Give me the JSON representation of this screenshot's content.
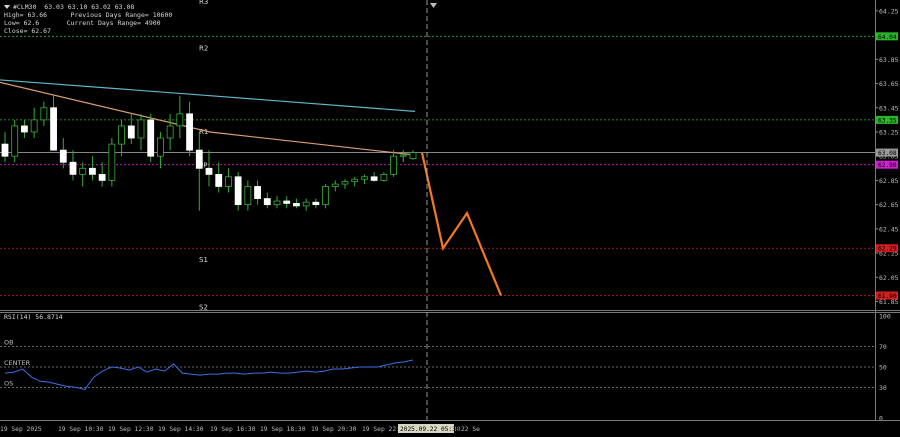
{
  "symbol_header": {
    "symbol_line": "#CLM30  63.03 63.10 63.02 63.08",
    "high": "High= 63.66",
    "prev_range": "Previous Days Range= 10600",
    "low": "Low= 62.6",
    "curr_range": "Current Days Range= 4900",
    "close": "Close= 62.67"
  },
  "pivot_labels": {
    "r2": "R2",
    "r1": "R1",
    "pp": "PP",
    "s1": "S1",
    "s2": "S2",
    "top_clipped": "R3"
  },
  "price_axis": {
    "ticks": [
      "64.25",
      "64.05",
      "63.85",
      "63.65",
      "63.45",
      "63.25",
      "63.05",
      "62.85",
      "62.65",
      "62.45",
      "62.25",
      "62.05",
      "61.85"
    ],
    "tags": [
      {
        "label": "64.04",
        "price": 64.04,
        "color": "#2bb52b"
      },
      {
        "label": "63.35",
        "price": 63.35,
        "color": "#2bb52b"
      },
      {
        "label": "63.08",
        "price": 63.08,
        "color": "#9a9a9a"
      },
      {
        "label": "62.98",
        "price": 62.98,
        "color": "#d020d0"
      },
      {
        "label": "62.29",
        "price": 62.29,
        "color": "#d02020"
      },
      {
        "label": "61.90",
        "price": 61.9,
        "color": "#d02020"
      }
    ]
  },
  "rsi": {
    "title": "RSI(14) 56.8714",
    "levels": {
      "ob": "OB",
      "center": "CENTER",
      "os": "OS"
    },
    "ticks": [
      "100",
      "70",
      "50",
      "30",
      "0"
    ],
    "values": [
      44,
      45,
      48,
      40,
      36,
      35,
      33,
      31,
      30,
      28,
      40,
      46,
      50,
      49,
      47,
      50,
      45,
      48,
      46,
      53,
      44,
      43,
      42,
      43,
      43,
      44,
      44,
      43,
      44,
      44,
      45,
      44,
      44,
      45,
      46,
      45,
      46,
      48,
      48,
      49,
      50,
      50,
      50,
      52,
      54,
      55,
      56.9
    ]
  },
  "time_axis": {
    "labels": [
      "19 Sep 2025",
      "19 Sep 10:30",
      "19 Sep 12:30",
      "19 Sep 14:30",
      "19 Sep 16:30",
      "19 Sep 18:30",
      "19 Sep 20:30",
      "19 Sep 22:30",
      "22 Sep 01:30",
      "22 Se"
    ],
    "cursor_label": "2025.09.22 05:30"
  },
  "chart_data": {
    "type": "candlestick",
    "y_range": [
      61.78,
      64.34
    ],
    "pivots": {
      "R2": 64.04,
      "R1": 63.35,
      "PP": 62.98,
      "S1": 62.29,
      "S2": 61.9
    },
    "candles": [
      [
        63.15,
        63.25,
        63.0,
        63.05
      ],
      [
        63.05,
        63.35,
        63.0,
        63.3
      ],
      [
        63.3,
        63.35,
        63.2,
        63.25
      ],
      [
        63.25,
        63.45,
        63.2,
        63.35
      ],
      [
        63.35,
        63.5,
        63.3,
        63.45
      ],
      [
        63.45,
        63.55,
        63.1,
        63.1
      ],
      [
        63.1,
        63.2,
        62.95,
        63.0
      ],
      [
        63.0,
        63.1,
        62.85,
        62.9
      ],
      [
        62.9,
        63.0,
        62.8,
        62.95
      ],
      [
        62.95,
        63.05,
        62.85,
        62.9
      ],
      [
        62.9,
        63.0,
        62.8,
        62.85
      ],
      [
        62.85,
        63.2,
        62.8,
        63.15
      ],
      [
        63.15,
        63.35,
        63.05,
        63.3
      ],
      [
        63.3,
        63.4,
        63.15,
        63.2
      ],
      [
        63.2,
        63.4,
        63.1,
        63.35
      ],
      [
        63.35,
        63.4,
        63.0,
        63.05
      ],
      [
        63.05,
        63.25,
        62.95,
        63.2
      ],
      [
        63.2,
        63.4,
        63.1,
        63.3
      ],
      [
        63.3,
        63.55,
        63.2,
        63.4
      ],
      [
        63.4,
        63.5,
        63.05,
        63.1
      ],
      [
        63.1,
        63.25,
        62.6,
        62.95
      ],
      [
        62.95,
        63.1,
        62.8,
        62.9
      ],
      [
        62.9,
        63.0,
        62.75,
        62.8
      ],
      [
        62.8,
        62.95,
        62.75,
        62.88
      ],
      [
        62.88,
        62.92,
        62.6,
        62.65
      ],
      [
        62.65,
        62.85,
        62.6,
        62.8
      ],
      [
        62.8,
        62.85,
        62.65,
        62.7
      ],
      [
        62.7,
        62.75,
        62.62,
        62.65
      ],
      [
        62.65,
        62.72,
        62.62,
        62.68
      ],
      [
        62.68,
        62.72,
        62.62,
        62.66
      ],
      [
        62.66,
        62.7,
        62.62,
        62.64
      ],
      [
        62.64,
        62.7,
        62.6,
        62.67
      ],
      [
        62.67,
        62.7,
        62.62,
        62.65
      ],
      [
        62.65,
        62.82,
        62.62,
        62.8
      ],
      [
        62.8,
        62.85,
        62.76,
        62.82
      ],
      [
        62.82,
        62.86,
        62.78,
        62.84
      ],
      [
        62.84,
        62.88,
        62.8,
        62.86
      ],
      [
        62.86,
        62.9,
        62.82,
        62.88
      ],
      [
        62.88,
        62.92,
        62.84,
        62.85
      ],
      [
        62.85,
        62.92,
        62.84,
        62.9
      ],
      [
        62.9,
        63.1,
        62.88,
        63.05
      ],
      [
        63.05,
        63.1,
        63.0,
        63.06
      ],
      [
        63.03,
        63.1,
        63.02,
        63.08
      ]
    ],
    "ma_slow": [
      63.68,
      63.55,
      63.42
    ],
    "ma_fast": [
      63.66,
      63.25,
      63.06
    ],
    "forecast_path": [
      63.08,
      62.29,
      62.58,
      61.9
    ]
  }
}
